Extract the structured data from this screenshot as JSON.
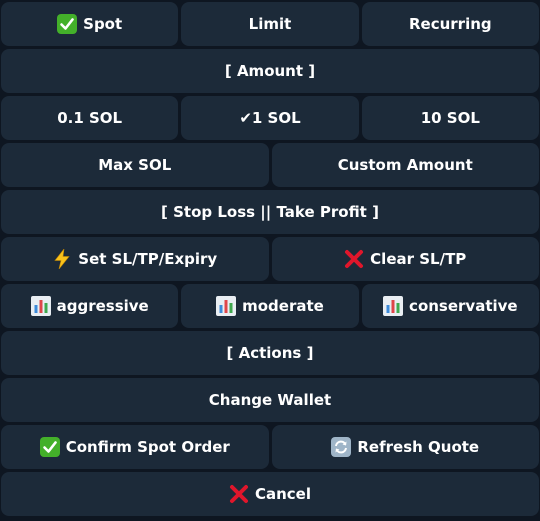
{
  "keyboard": {
    "order_types": {
      "spot_label": "Spot",
      "limit_label": "Limit",
      "recurring_label": "Recurring"
    },
    "amount_header": "[ Amount ]",
    "amounts": {
      "a1_label": "0.1 SOL",
      "a2_label": "✔1 SOL",
      "a3_label": "10 SOL",
      "max_label": "Max SOL",
      "custom_label": "Custom Amount"
    },
    "sltp_header": "[ Stop Loss || Take Profit ]",
    "sltp": {
      "set_label": "Set SL/TP/Expiry",
      "clear_label": "Clear SL/TP"
    },
    "presets": {
      "aggressive_label": "aggressive",
      "moderate_label": "moderate",
      "conservative_label": "conservative"
    },
    "actions_header": "[ Actions ]",
    "actions": {
      "change_wallet_label": "Change Wallet",
      "confirm_label": "Confirm Spot Order",
      "refresh_label": "Refresh Quote",
      "cancel_label": "Cancel"
    }
  },
  "icons": {
    "check": "white-check-mark-emoji",
    "zap": "high-voltage-emoji",
    "cross": "cross-mark-emoji",
    "chart": "bar-chart-emoji",
    "refresh": "counterclockwise-arrows-emoji"
  },
  "colors": {
    "background": "#0e1621",
    "button": "#1c2a39",
    "text": "#ffffff",
    "check_green": "#43b02a",
    "cross_red": "#e0162b",
    "zap_yellow": "#f9c21b",
    "refresh_blue": "#4c8fd6"
  }
}
